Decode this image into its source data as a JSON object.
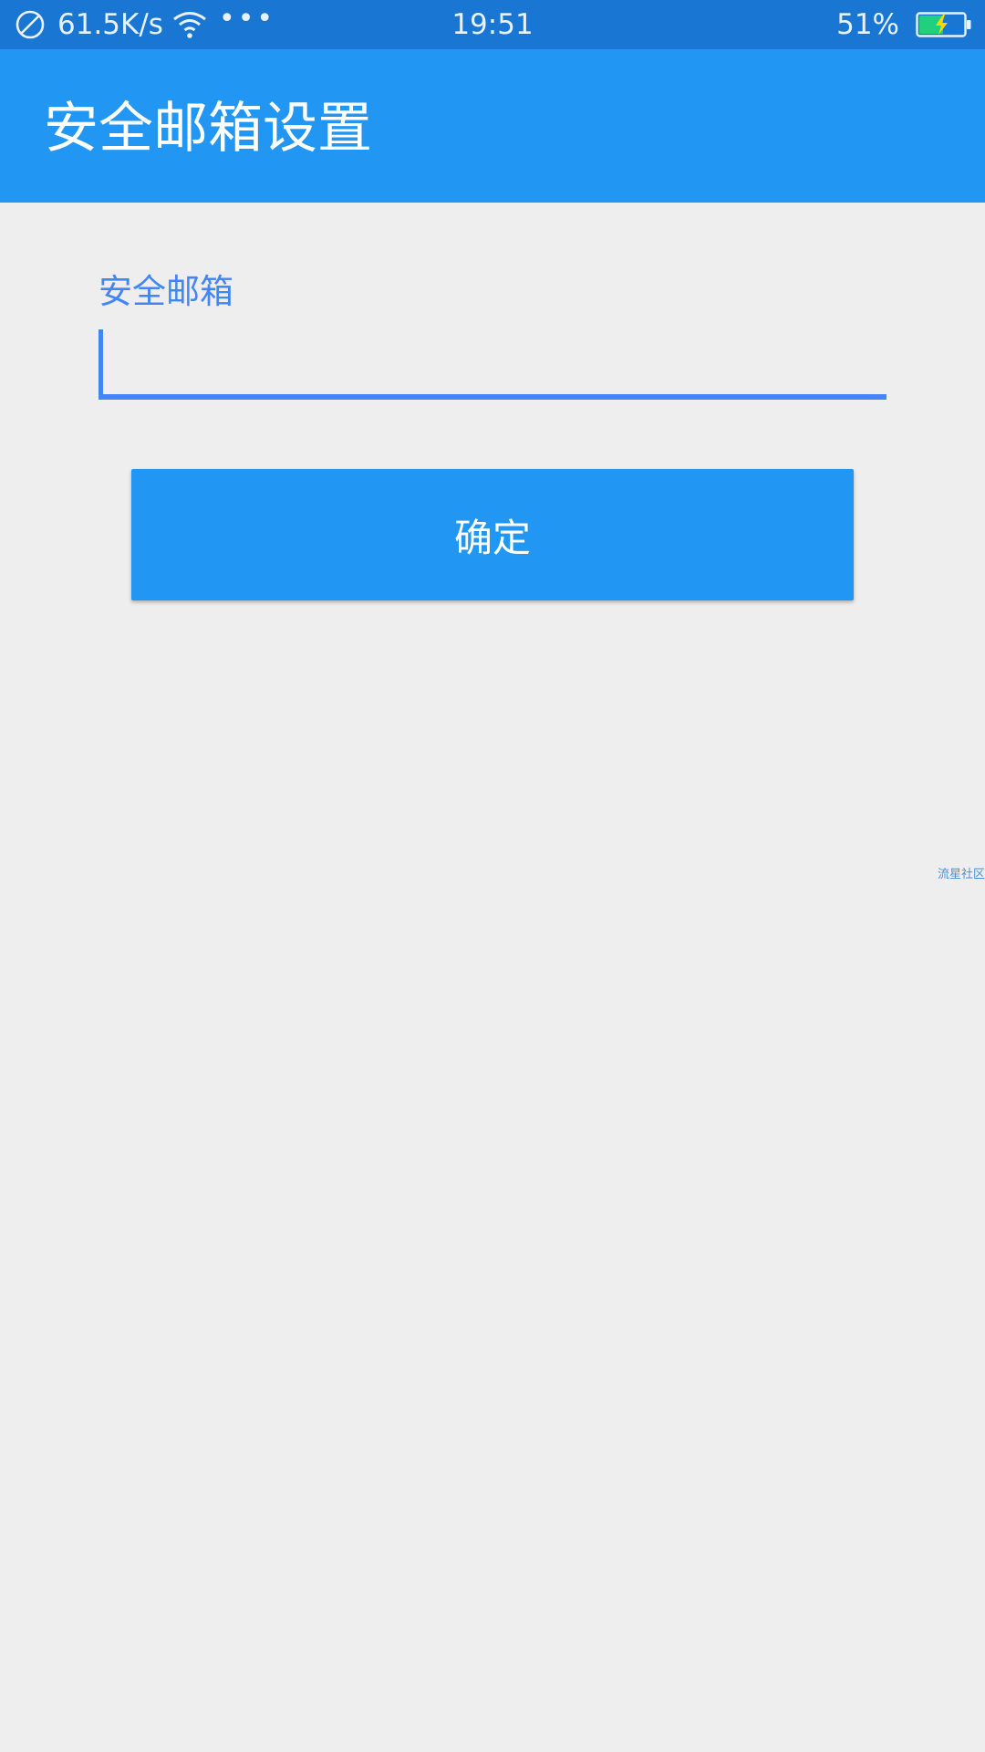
{
  "status_bar": {
    "speed": "61.5K/s",
    "dots": "•••",
    "time": "19:51",
    "battery_percent": "51%",
    "icons": [
      "block-icon",
      "wifi-icon",
      "battery-charging-icon"
    ]
  },
  "app_bar": {
    "title": "安全邮箱设置"
  },
  "form": {
    "email_label": "安全邮箱",
    "email_value": "",
    "confirm_label": "确定"
  },
  "watermark": "流星社区",
  "colors": {
    "status_bar": "#1976d2",
    "primary": "#2196f3",
    "accent": "#4285f4",
    "background": "#eeeeee"
  }
}
